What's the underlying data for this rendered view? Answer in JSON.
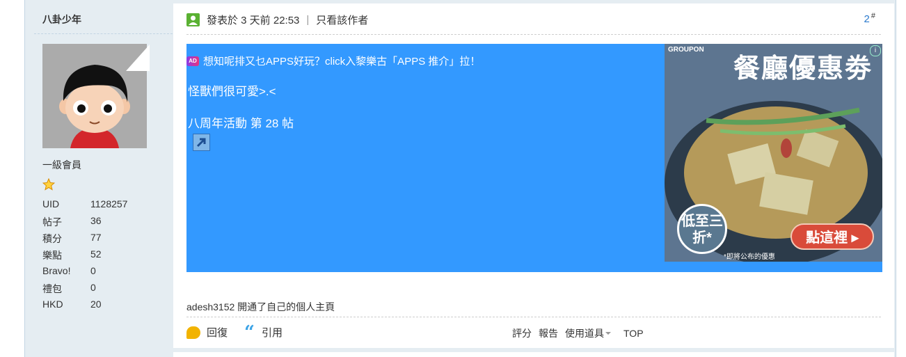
{
  "author": {
    "username": "八卦少年",
    "level": "一級會員",
    "stats": [
      {
        "label": "UID",
        "value": "1128257"
      },
      {
        "label": "帖子",
        "value": "36"
      },
      {
        "label": "積分",
        "value": "77"
      },
      {
        "label": "樂點",
        "value": "52"
      },
      {
        "label": "Bravo!",
        "value": "0"
      },
      {
        "label": "禮包",
        "value": "0"
      },
      {
        "label": "HKD",
        "value": "20"
      }
    ]
  },
  "post": {
    "posted_text": "發表於 3 天前 22:53",
    "separator": "|",
    "only_author": "只看該作者",
    "floor_number": "2",
    "floor_mark": "#",
    "ad_text": "想知呢排又乜APPS好玩？click入黎樂古「APPS 推介」拉！",
    "ad_badge": "AD",
    "body_line1": "怪獸們很可愛>.<",
    "body_line2": "八周年活動 第 28 帖",
    "activity_user": "adesh3152",
    "activity_text": " 開通了自己的個人主頁"
  },
  "advert": {
    "brand": "GROUPON",
    "title": "餐廳優惠劵",
    "promo": "低至三折*",
    "cta": "點這裡 ▸",
    "footnote": "*即將公布的優惠"
  },
  "actions": {
    "reply": "回復",
    "quote": "引用",
    "rate": "評分",
    "report": "報告",
    "use_tools": "使用道具",
    "top": "TOP"
  },
  "colors": {
    "selection": "#3399ff",
    "sidebar_bg": "#e5edf2",
    "floor_link": "#2b7acd",
    "online_icon": "#5ab132"
  }
}
